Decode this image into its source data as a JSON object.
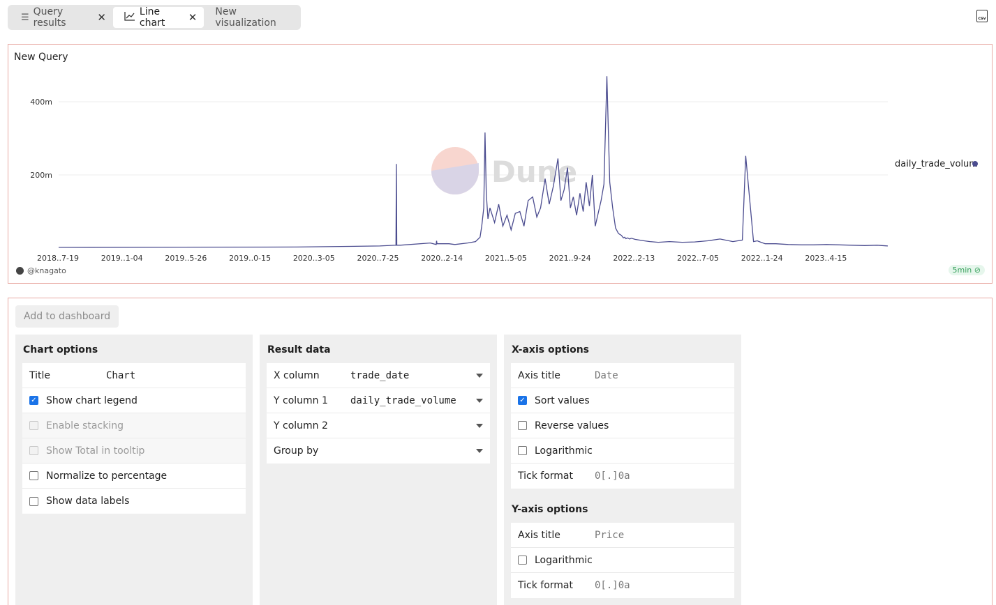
{
  "tabs": [
    {
      "label": "Query results",
      "icon": "list-icon",
      "active": false
    },
    {
      "label": "Line chart",
      "icon": "line-chart-icon",
      "active": true
    },
    {
      "label": "New visualization",
      "icon": "",
      "active": false
    }
  ],
  "csv_label": "csv",
  "chart": {
    "title": "New Query",
    "author": "@knagato",
    "refresh": "5min",
    "watermark": "Dune",
    "legend": "daily_trade_volum"
  },
  "chart_data": {
    "type": "line",
    "title": "New Query",
    "x_tick_labels": [
      "2018..7-19",
      "2019..1-04",
      "2019..5-26",
      "2019..0-15",
      "2020..3-05",
      "2020..7-25",
      "2020..2-14",
      "2021..5-05",
      "2021..9-24",
      "2022..2-13",
      "2022..7-05",
      "2022..1-24",
      "2023..4-15"
    ],
    "y_tick_labels": [
      "200m",
      "400m"
    ],
    "y_ticks": [
      200000000,
      400000000
    ],
    "ylim": [
      0,
      480000000
    ],
    "grid": true,
    "legend_position": "right",
    "color": "#4b4c8f",
    "series": [
      {
        "name": "daily_trade_volum",
        "x": [
          "2018-07-19",
          "2020-02-14",
          "2020-09-01",
          "2020-10-10",
          "2020-10-11",
          "2020-10-12",
          "2020-10-20",
          "2021-01-01",
          "2021-01-15",
          "2021-01-16",
          "2021-01-17",
          "2021-02-15",
          "2021-03-01",
          "2021-04-01",
          "2021-04-20",
          "2021-05-01",
          "2021-05-05",
          "2021-05-10",
          "2021-05-13",
          "2021-05-16",
          "2021-05-20",
          "2021-05-25",
          "2021-06-05",
          "2021-06-15",
          "2021-06-25",
          "2021-07-05",
          "2021-07-15",
          "2021-07-25",
          "2021-08-05",
          "2021-08-15",
          "2021-08-25",
          "2021-09-05",
          "2021-09-15",
          "2021-09-24",
          "2021-10-05",
          "2021-10-15",
          "2021-10-25",
          "2021-11-05",
          "2021-11-12",
          "2021-11-20",
          "2021-11-28",
          "2021-12-05",
          "2021-12-12",
          "2021-12-20",
          "2021-12-28",
          "2022-01-05",
          "2022-01-12",
          "2022-01-20",
          "2022-01-27",
          "2022-02-03",
          "2022-02-10",
          "2022-02-17",
          "2022-02-24",
          "2022-03-03",
          "2022-03-10",
          "2022-03-17",
          "2022-03-24",
          "2022-03-31",
          "2022-04-07",
          "2022-04-12",
          "2022-04-15",
          "2022-04-18",
          "2022-04-22",
          "2022-04-27",
          "2022-05-01",
          "2022-05-10",
          "2022-05-20",
          "2022-06-01",
          "2022-06-15",
          "2022-07-05",
          "2022-08-01",
          "2022-09-01",
          "2022-10-01",
          "2022-11-01",
          "2022-12-01",
          "2023-01-01",
          "2023-01-24",
          "2023-02-01",
          "2023-02-20",
          "2023-03-01",
          "2023-03-10",
          "2023-03-20",
          "2023-04-15",
          "2023-05-15",
          "2023-06-15",
          "2023-07-15",
          "2023-08-15",
          "2023-09-15",
          "2023-10-15",
          "2023-11-15",
          "2023-12-15",
          "2024-01-10"
        ],
        "values": [
          2000000,
          3000000,
          6000000,
          8000000,
          230000000,
          8000000,
          8000000,
          14000000,
          10000000,
          20000000,
          12000000,
          12000000,
          10000000,
          14000000,
          18000000,
          30000000,
          60000000,
          110000000,
          316000000,
          150000000,
          80000000,
          110000000,
          70000000,
          120000000,
          60000000,
          90000000,
          50000000,
          95000000,
          100000000,
          60000000,
          130000000,
          140000000,
          85000000,
          110000000,
          190000000,
          120000000,
          170000000,
          245000000,
          130000000,
          160000000,
          220000000,
          110000000,
          140000000,
          90000000,
          150000000,
          100000000,
          180000000,
          115000000,
          200000000,
          60000000,
          95000000,
          130000000,
          175000000,
          470000000,
          180000000,
          110000000,
          55000000,
          40000000,
          35000000,
          28000000,
          30000000,
          26000000,
          28000000,
          25000000,
          27000000,
          24000000,
          22000000,
          20000000,
          18000000,
          16000000,
          18000000,
          16000000,
          17000000,
          20000000,
          25000000,
          18000000,
          22000000,
          252000000,
          18000000,
          20000000,
          16000000,
          12000000,
          12000000,
          10000000,
          9000000,
          9000000,
          10000000,
          9000000,
          8000000,
          7000000,
          8000000,
          6000000
        ]
      }
    ]
  },
  "settings": {
    "add_to_dashboard": "Add to dashboard",
    "chart_options": {
      "heading": "Chart options",
      "title_label": "Title",
      "title_value": "Chart",
      "show_legend": "Show chart legend",
      "enable_stacking": "Enable stacking",
      "show_total": "Show Total in tooltip",
      "normalize": "Normalize to percentage",
      "data_labels": "Show data labels"
    },
    "result_data": {
      "heading": "Result data",
      "x_label": "X column",
      "x_value": "trade_date",
      "y1_label": "Y column 1",
      "y1_value": "daily_trade_volume",
      "y2_label": "Y column 2",
      "y2_value": "",
      "group_label": "Group by",
      "group_value": ""
    },
    "x_axis": {
      "heading": "X-axis options",
      "axis_title_label": "Axis title",
      "axis_title_placeholder": "Date",
      "sort": "Sort values",
      "reverse": "Reverse values",
      "log": "Logarithmic",
      "tick_label": "Tick format",
      "tick_placeholder": "0[.]0a"
    },
    "y_axis": {
      "heading": "Y-axis options",
      "axis_title_label": "Axis title",
      "axis_title_placeholder": "Price",
      "log": "Logarithmic",
      "tick_label": "Tick format",
      "tick_placeholder": "0[.]0a"
    }
  }
}
